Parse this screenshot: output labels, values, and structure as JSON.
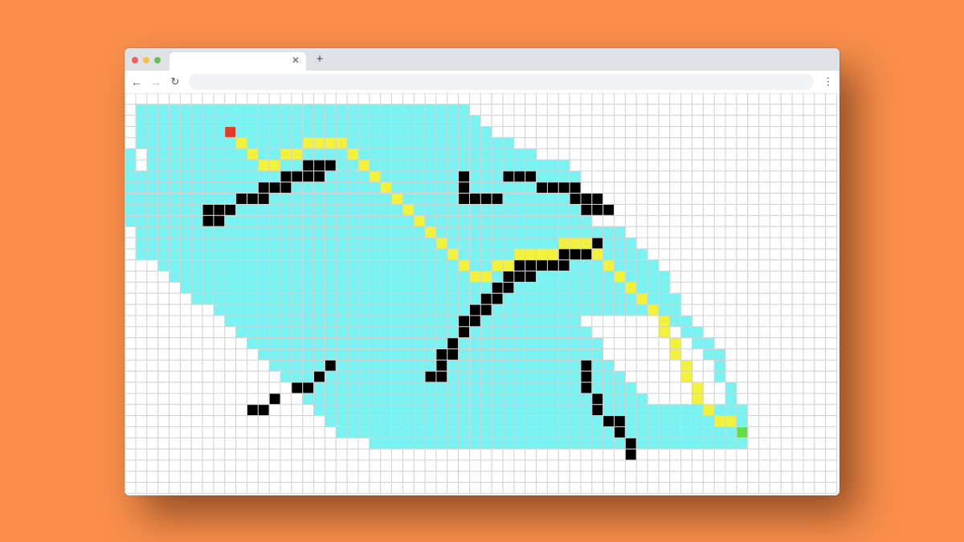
{
  "browser": {
    "tab_title": "",
    "tab_close_icon": "close-icon",
    "new_tab_label": "+",
    "address_value": "",
    "address_placeholder": "",
    "nav_icons": [
      "back-arrow-icon",
      "forward-arrow-icon",
      "reload-icon"
    ],
    "menu_icon": "kebab-menu-icon"
  },
  "grid_app": {
    "cols": 64,
    "rows": 36,
    "colors": {
      "empty": "#ffffff",
      "gridline": "#d3d3d3",
      "visited": "#79f2f2",
      "wall": "#000000",
      "path": "#f2f23a",
      "start": "#e53a26",
      "goal": "#5fe044"
    },
    "start": [
      8,
      3
    ],
    "goal": [
      54,
      30
    ],
    "visited_rows": [
      [
        1,
        0,
        29
      ],
      [
        2,
        0,
        30
      ],
      [
        3,
        0,
        31
      ],
      [
        4,
        0,
        33
      ],
      [
        5,
        1,
        35
      ],
      [
        6,
        1,
        38
      ],
      [
        7,
        0,
        39
      ],
      [
        8,
        0,
        39
      ],
      [
        9,
        0,
        39
      ],
      [
        10,
        0,
        40
      ],
      [
        11,
        0,
        40
      ],
      [
        12,
        0,
        43
      ],
      [
        13,
        0,
        44
      ],
      [
        14,
        0,
        45
      ],
      [
        15,
        2,
        46
      ],
      [
        16,
        3,
        47
      ],
      [
        17,
        4,
        47
      ],
      [
        18,
        5,
        48
      ],
      [
        19,
        7,
        48
      ],
      [
        20,
        8,
        49
      ],
      [
        21,
        9,
        50
      ],
      [
        22,
        10,
        51
      ],
      [
        23,
        11,
        52
      ],
      [
        24,
        12,
        52
      ],
      [
        25,
        13,
        52
      ],
      [
        26,
        14,
        53
      ],
      [
        27,
        15,
        53
      ],
      [
        28,
        16,
        54
      ],
      [
        29,
        17,
        54
      ],
      [
        30,
        18,
        54
      ],
      [
        31,
        21,
        54
      ]
    ],
    "visited_holes": [
      [
        20,
        40,
        31,
        47
      ],
      [
        21,
        41,
        31,
        48
      ],
      [
        22,
        42,
        31,
        49
      ],
      [
        23,
        42,
        31,
        50
      ],
      [
        24,
        43,
        31,
        51
      ],
      [
        25,
        44,
        31,
        51
      ],
      [
        26,
        45,
        31,
        52
      ],
      [
        27,
        46,
        31,
        52
      ]
    ],
    "walls": [
      [
        6,
        5
      ],
      [
        9,
        5
      ],
      [
        5,
        5
      ],
      [
        4,
        5
      ],
      [
        4,
        2
      ],
      [
        3,
        2
      ],
      [
        2,
        2
      ],
      [
        2,
        5
      ],
      [
        1,
        5
      ],
      [
        1,
        2
      ],
      [
        26,
        3
      ],
      [
        28,
        6
      ],
      [
        29,
        7
      ],
      [
        31,
        10
      ],
      [
        33,
        13
      ],
      [
        34,
        15
      ],
      [
        36,
        17
      ],
      [
        37,
        18
      ],
      [
        13,
        3
      ],
      [
        12,
        3
      ],
      [
        13,
        4
      ],
      [
        14,
        4
      ],
      [
        15,
        4
      ],
      [
        16,
        5
      ],
      [
        17,
        5
      ],
      [
        18,
        6
      ],
      [
        18,
        7
      ]
    ],
    "wall_runs": [
      [
        6,
        15,
        17
      ],
      [
        7,
        13,
        16
      ],
      [
        8,
        11,
        13
      ],
      [
        9,
        9,
        11
      ],
      [
        10,
        6,
        8
      ],
      [
        11,
        6,
        7
      ],
      [
        8,
        29,
        29
      ],
      [
        9,
        29,
        32
      ],
      [
        7,
        29,
        29
      ],
      [
        7,
        33,
        35
      ],
      [
        8,
        36,
        39
      ],
      [
        9,
        39,
        41
      ],
      [
        10,
        40,
        42
      ],
      [
        13,
        40,
        41
      ],
      [
        14,
        38,
        41
      ],
      [
        15,
        34,
        38
      ],
      [
        16,
        33,
        35
      ],
      [
        17,
        32,
        33
      ],
      [
        18,
        31,
        32
      ],
      [
        19,
        30,
        31
      ],
      [
        20,
        29,
        30
      ],
      [
        21,
        29,
        29
      ],
      [
        22,
        28,
        28
      ],
      [
        23,
        27,
        28
      ],
      [
        24,
        27,
        27
      ],
      [
        25,
        26,
        27
      ],
      [
        24,
        17,
        17
      ],
      [
        25,
        16,
        16
      ],
      [
        26,
        14,
        15
      ],
      [
        27,
        12,
        12
      ],
      [
        28,
        10,
        11
      ],
      [
        24,
        40,
        40
      ],
      [
        25,
        40,
        40
      ],
      [
        26,
        40,
        40
      ],
      [
        27,
        41,
        41
      ],
      [
        28,
        41,
        41
      ],
      [
        29,
        42,
        43
      ],
      [
        30,
        43,
        43
      ],
      [
        31,
        44,
        44
      ],
      [
        32,
        44,
        44
      ]
    ],
    "path": [
      [
        9,
        4
      ],
      [
        10,
        5
      ],
      [
        11,
        6
      ],
      [
        12,
        6
      ],
      [
        13,
        5
      ],
      [
        14,
        5
      ],
      [
        15,
        4
      ],
      [
        16,
        4
      ],
      [
        17,
        4
      ],
      [
        18,
        4
      ],
      [
        19,
        5
      ],
      [
        20,
        6
      ],
      [
        21,
        7
      ],
      [
        22,
        8
      ],
      [
        23,
        9
      ],
      [
        24,
        10
      ],
      [
        25,
        11
      ],
      [
        26,
        12
      ],
      [
        27,
        13
      ],
      [
        28,
        14
      ],
      [
        29,
        15
      ],
      [
        30,
        16
      ],
      [
        31,
        16
      ],
      [
        32,
        15
      ],
      [
        33,
        15
      ],
      [
        34,
        14
      ],
      [
        35,
        14
      ],
      [
        36,
        14
      ],
      [
        37,
        14
      ],
      [
        38,
        13
      ],
      [
        39,
        13
      ],
      [
        40,
        13
      ],
      [
        41,
        14
      ],
      [
        42,
        15
      ],
      [
        43,
        16
      ],
      [
        44,
        17
      ],
      [
        45,
        18
      ],
      [
        46,
        19
      ],
      [
        47,
        20
      ],
      [
        47,
        21
      ],
      [
        48,
        22
      ],
      [
        48,
        23
      ],
      [
        49,
        24
      ],
      [
        49,
        25
      ],
      [
        50,
        26
      ],
      [
        50,
        27
      ],
      [
        51,
        28
      ],
      [
        52,
        29
      ],
      [
        53,
        29
      ]
    ]
  }
}
